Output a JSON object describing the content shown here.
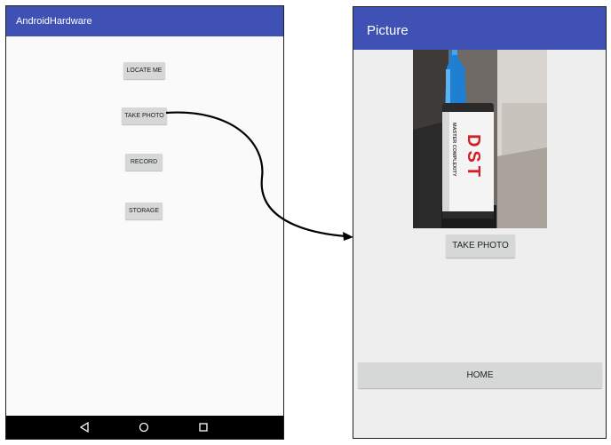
{
  "left_screen": {
    "app_title": "AndroidHardware",
    "buttons": {
      "locate_me": "LOCATE ME",
      "take_photo": "TAKE PHOTO",
      "record": "RECORD",
      "storage": "STORAGE"
    },
    "nav_icons": [
      "back-icon",
      "home-circle-icon",
      "recents-square-icon"
    ]
  },
  "right_screen": {
    "app_title": "Picture",
    "photo": {
      "bottle_label": "DST",
      "bottle_side_text": "MASTER COMPLEXITY"
    },
    "buttons": {
      "take_photo": "TAKE PHOTO",
      "home": "HOME"
    }
  },
  "colors": {
    "app_bar": "#3f51b5",
    "button_bg": "#d6d7d7",
    "screen_bg_left": "#fafafa",
    "screen_bg_right": "#eeeeee",
    "nav_bar": "#000000",
    "arrow": "#000000"
  }
}
